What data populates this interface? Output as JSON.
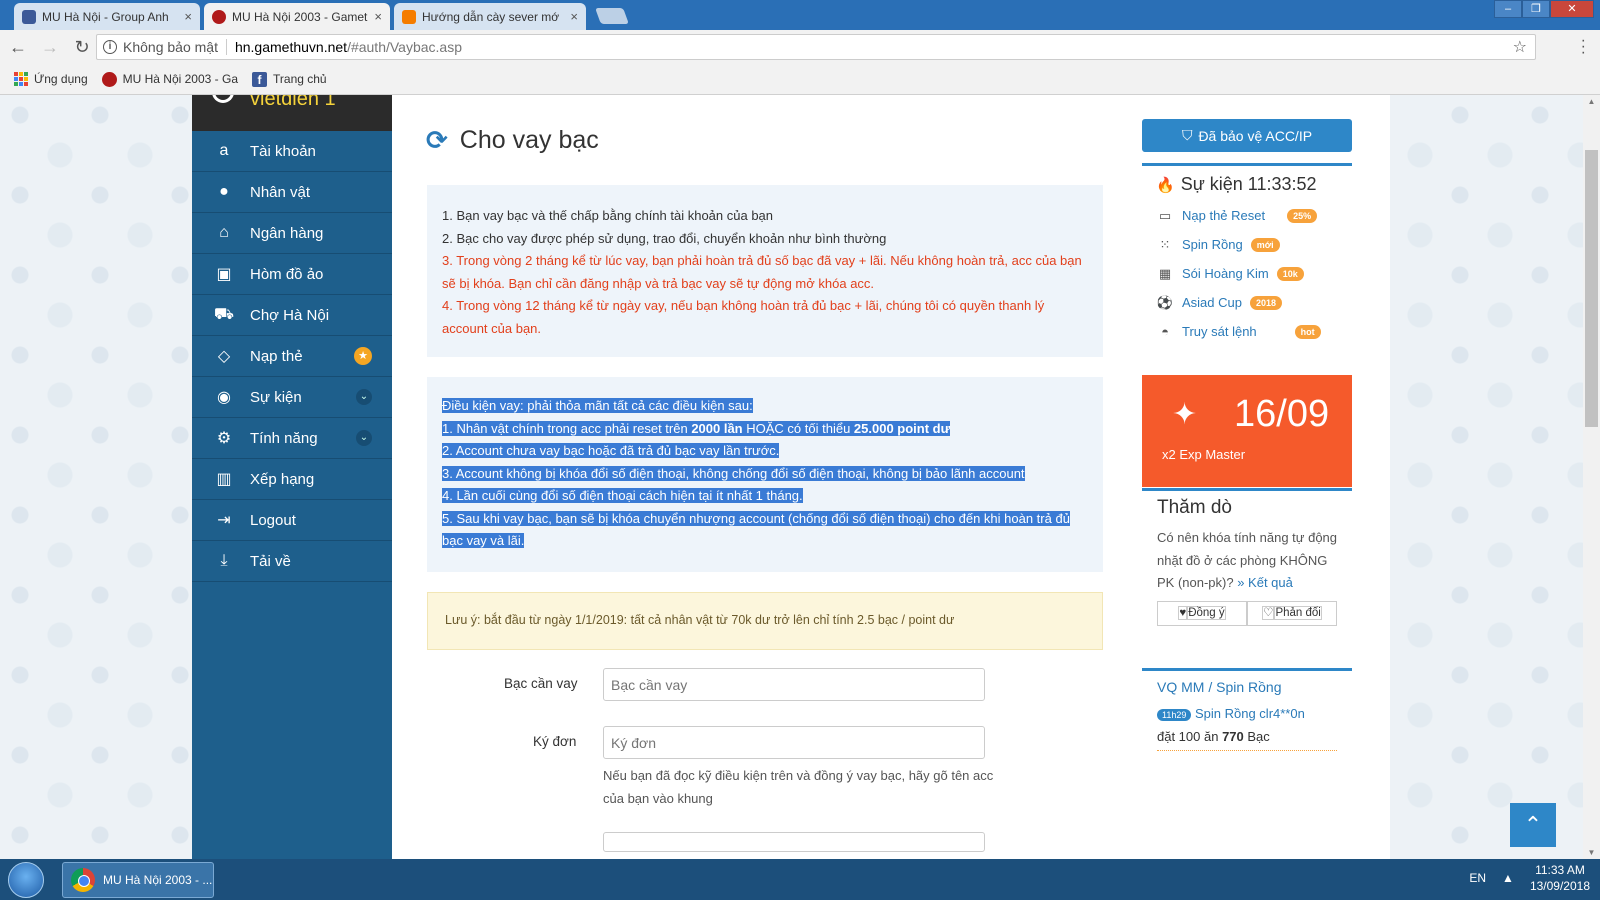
{
  "browser": {
    "tabs": [
      {
        "title": "MU Hà Nội - Group Anh",
        "icon": "facebook-icon",
        "active": false
      },
      {
        "title": "MU Hà Nội 2003 - Gamet",
        "icon": "mu-icon",
        "active": true
      },
      {
        "title": "Hướng dẫn cày sever mớ",
        "icon": "blogger-icon",
        "active": false
      }
    ],
    "close_glyph": "×",
    "security_label": "Không bảo mật",
    "url_host": "hn.gamethuvn.net",
    "url_path": "/#auth/Vaybac.asp",
    "bookmarks": [
      {
        "label": "Ứng dụng",
        "icon": "apps-icon"
      },
      {
        "label": "MU Hà Nội 2003 - Ga",
        "icon": "mu-icon"
      },
      {
        "label": "Trang chủ",
        "icon": "facebook-icon"
      }
    ]
  },
  "site": {
    "brand_partial": "vietdien 1",
    "sidebar": [
      {
        "label": "Tài khoản",
        "icon": "account-icon"
      },
      {
        "label": "Nhân vật",
        "icon": "user-icon"
      },
      {
        "label": "Ngân hàng",
        "icon": "bank-icon"
      },
      {
        "label": "Hòm đồ ảo",
        "icon": "briefcase-icon"
      },
      {
        "label": "Chợ Hà Nội",
        "icon": "cart-icon"
      },
      {
        "label": "Nạp thẻ",
        "icon": "diamond-icon"
      },
      {
        "label": "Sự kiện",
        "icon": "android-icon"
      },
      {
        "label": "Tính năng",
        "icon": "gears-icon"
      },
      {
        "label": "Xếp hạng",
        "icon": "bar-chart-icon"
      },
      {
        "label": "Logout",
        "icon": "sign-out-icon"
      },
      {
        "label": "Tải về",
        "icon": "download-icon"
      }
    ],
    "page_title": "Cho vay bạc",
    "rules": [
      "1. Bạn vay bạc và thế chấp bằng chính tài khoản của bạn",
      "2. Bạc cho vay được phép sử dụng, trao đổi, chuyển khoản như bình thường",
      "3. Trong vòng 2 tháng kể từ lúc vay, bạn phải hoàn trả đủ số bạc đã vay + lãi. Nếu không hoàn trả, acc của bạn sẽ bị khóa. Bạn chỉ cần đăng nhập và trả bạc vay sẽ tự động mở khóa acc.",
      "4. Trong vòng 12 tháng kể từ ngày vay, nếu bạn không hoàn trả đủ bạc + lãi, chúng tôi có quyền thanh lý account của bạn."
    ],
    "conditions": {
      "heading": "Điều kiện vay: phải thỏa mãn tất cả các điều kiện sau:",
      "c1_a": "1. Nhân vật chính trong acc phải reset trên ",
      "c1_b": "2000 lần",
      "c1_c": " HOẶC có tối thiểu ",
      "c1_d": "25.000 point dư",
      "c2": "2. Account chưa vay bạc hoặc đã trả đủ bạc vay lần trước.",
      "c3": "3. Account không bị khóa đổi số điện thoại, không chống đổi số điện thoại, không bị bảo lãnh account",
      "c4": "4. Lần cuối cùng đổi số điện thoại cách hiện tại ít nhất 1 tháng.",
      "c5a": "5. Sau khi vay bạc, bạn sẽ bị khóa chuyển nhượng account (chống đổi số điện thoại) cho đến khi hoàn trả đủ",
      "c5b": "bạc vay và lãi."
    },
    "note": "Lưu ý: bắt đầu từ ngày 1/1/2019: tất cả nhân vật từ 70k dư trở lên chỉ tính 2.5 bạc / point dư",
    "form": {
      "amount_label": "Bạc cần vay",
      "amount_placeholder": "Bạc cần vay",
      "sign_label": "Ký đơn",
      "sign_placeholder": "Ký đơn",
      "help": "Nếu bạn đã đọc kỹ điều kiện trên và đồng ý vay bạc, hãy gõ tên acc của bạn vào khung"
    },
    "right": {
      "protect_button": "Đã bảo vệ ACC/IP",
      "events_title": "Sự kiện 11:33:52",
      "events": [
        {
          "label": "Nạp thẻ Reset",
          "tag": "25%",
          "icon": "money-icon"
        },
        {
          "label": "Spin Rồng",
          "tag": "mới",
          "icon": "spinner-icon"
        },
        {
          "label": "Sói Hoàng Kim",
          "tag": "10k",
          "icon": "gift-icon"
        },
        {
          "label": "Asiad Cup",
          "tag": "2018",
          "icon": "soccer-ball-icon"
        },
        {
          "label": "Truy sát lệnh",
          "tag": "hot",
          "icon": "cat-icon"
        }
      ],
      "promo_date": "16/09",
      "promo_text": "x2 Exp Master",
      "poll_title": "Thăm dò",
      "poll_question": "Có nên khóa tính năng tự động nhặt đồ ở các phòng KHÔNG PK (non-pk)?",
      "poll_result_link": "» Kết quả",
      "poll_agree": "Đồng ý",
      "poll_disagree": "Phản đối",
      "spin_title_a": "VQ MM",
      "spin_title_sep": " / ",
      "spin_title_b": "Spin Rồng",
      "spin_time": "11h29",
      "spin_link": "Spin Rồng clr4**0n",
      "spin_text_a": "đặt 100 ăn ",
      "spin_amount": "770",
      "spin_text_b": " Bạc"
    }
  },
  "taskbar": {
    "window_title": "MU Hà Nội 2003 - ...",
    "lang": "EN",
    "time": "11:33 AM",
    "date": "13/09/2018"
  },
  "colors": {
    "sidebar_bg": "#1e5f8c",
    "accent": "#2e87c8",
    "promo": "#f55a2b",
    "rule_red": "#e2401c",
    "tag_orange": "#f7a23b"
  }
}
